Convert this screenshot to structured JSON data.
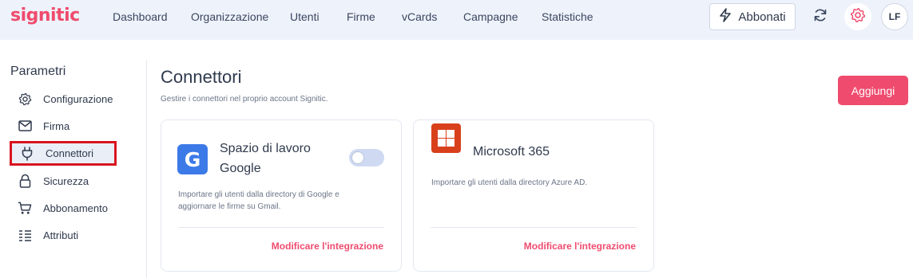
{
  "header": {
    "logo": "signitic",
    "nav": [
      "Dashboard",
      "Organizzazione",
      "Utenti",
      "Firme",
      "vCards",
      "Campagne",
      "Statistiche"
    ],
    "subscribe_label": "Abbonati",
    "avatar_initials": "LF"
  },
  "sidebar": {
    "title": "Parametri",
    "items": [
      {
        "label": "Configurazione",
        "icon": "gear-icon"
      },
      {
        "label": "Firma",
        "icon": "envelope-icon"
      },
      {
        "label": "Connettori",
        "icon": "plug-icon",
        "active": true
      },
      {
        "label": "Sicurezza",
        "icon": "lock-icon"
      },
      {
        "label": "Abbonamento",
        "icon": "cart-icon"
      },
      {
        "label": "Attributi",
        "icon": "list-icon"
      }
    ]
  },
  "main": {
    "title": "Connettori",
    "subtitle": "Gestire i connettori nel proprio account Signitic.",
    "add_label": "Aggiungi",
    "cards": [
      {
        "title_line1": "Spazio di lavoro",
        "title_line2": "Google",
        "desc_line1": "Importare gli utenti dalla directory di Google e",
        "desc_line2": "aggiornare le firme su Gmail.",
        "link": "Modificare l'integrazione",
        "toggle_on": false,
        "logo_letter": "G"
      },
      {
        "title": "Microsoft 365",
        "desc": "Importare gli utenti dalla directory Azure AD.",
        "link": "Modificare l'integrazione"
      }
    ]
  },
  "colors": {
    "accent": "#ef4b6e",
    "topbar_bg": "#eef2fa",
    "highlight_border": "#d8141f"
  }
}
